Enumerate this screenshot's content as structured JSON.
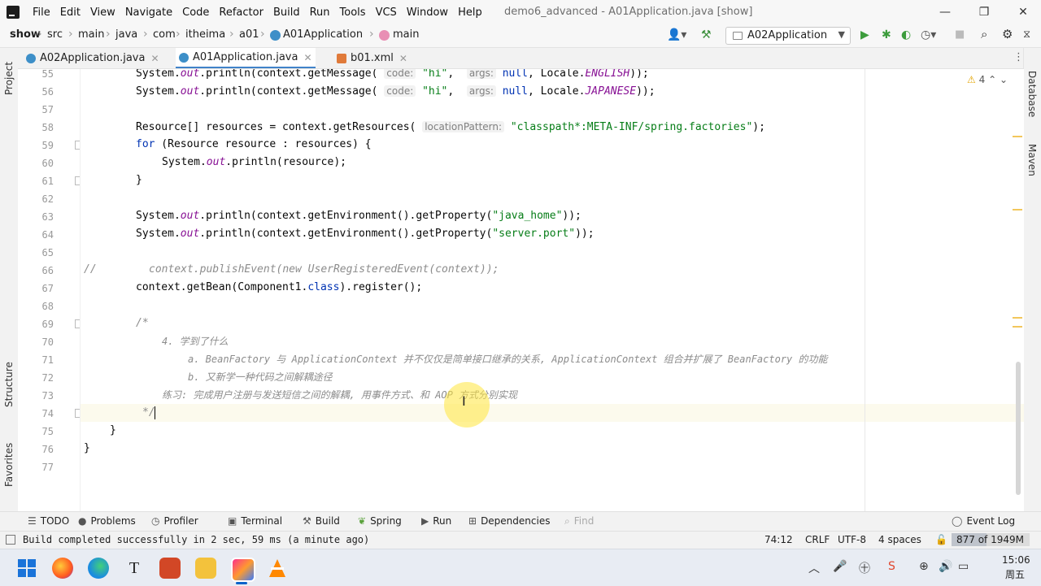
{
  "window": {
    "menu": [
      "File",
      "Edit",
      "View",
      "Navigate",
      "Code",
      "Refactor",
      "Build",
      "Run",
      "Tools",
      "VCS",
      "Window",
      "Help"
    ],
    "title": "demo6_advanced - A01Application.java [show]"
  },
  "breadcrumbs": [
    "show",
    "src",
    "main",
    "java",
    "com",
    "itheima",
    "a01",
    "A01Application",
    "main"
  ],
  "run_config": "A02Application",
  "tabs": [
    {
      "label": "A02Application.java",
      "active": false
    },
    {
      "label": "A01Application.java",
      "active": true
    },
    {
      "label": "b01.xml",
      "active": false
    }
  ],
  "left_strip": {
    "project": "Project",
    "structure": "Structure",
    "favorites": "Favorites"
  },
  "right_strip": {
    "database": "Database",
    "maven": "Maven"
  },
  "inspection": {
    "count": "4"
  },
  "line_numbers": [
    "55",
    "56",
    "57",
    "58",
    "59",
    "60",
    "61",
    "62",
    "63",
    "64",
    "65",
    "66",
    "67",
    "68",
    "69",
    "70",
    "71",
    "72",
    "73",
    "74",
    "75",
    "76",
    "77"
  ],
  "code": {
    "l55_a": "System.",
    "l55_b": "out",
    "l55_c": ".println(context.getMessage(",
    "l55_hint1": "code:",
    "l55_str": "\"hi\"",
    "l55_hint2": "args:",
    "l55_null": "null",
    "l55_d": ", Locale.",
    "l55_e": "ENGLISH",
    "l55_f": "));",
    "l56_e": "JAPANESE",
    "l58_a": "Resource[] resources = context.getResources(",
    "l58_hint": "locationPattern:",
    "l58_str": "\"classpath*:META-INF/spring.factories\"",
    "l58_b": ");",
    "l59_kw": "for",
    "l59_b": " (Resource resource : resources) {",
    "l60_a": "System.",
    "l60_b": "out",
    "l60_c": ".println(resource);",
    "l61": "}",
    "l63_c": ".println(context.getEnvironment().getProperty(",
    "l63_str": "\"java_home\"",
    "l63_d": "));",
    "l64_str": "\"server.port\"",
    "l66_a": "//",
    "l66_b": "context.publishEvent(new UserRegisteredEvent(context));",
    "l67_a": "context.getBean(Component1.",
    "l67_kw": "class",
    "l67_b": ").register();",
    "l69": "/*",
    "l70": "4. 学到了什么",
    "l71": "a. BeanFactory 与 ApplicationContext 并不仅仅是简单接口继承的关系, ApplicationContext 组合并扩展了 BeanFactory 的功能",
    "l72": "b. 又新学一种代码之间解耦途径",
    "l73": "练习: 完成用户注册与发送短信之间的解耦, 用事件方式、和 AOP 方式分别实现",
    "l74": "*/",
    "l75": "}",
    "l76": "}"
  },
  "bottom_tools": [
    "TODO",
    "Problems",
    "Profiler",
    "Terminal",
    "Build",
    "Spring",
    "Run",
    "Dependencies",
    "Find"
  ],
  "event_log": "Event Log",
  "status": {
    "message": "Build completed successfully in 2 sec, 59 ms (a minute ago)",
    "position": "74:12",
    "line_sep": "CRLF",
    "encoding": "UTF-8",
    "indent": "4 spaces",
    "memory": "877 of 1949M"
  },
  "taskbar": {
    "time": "15:06",
    "day": "周五",
    "text_app": "T"
  }
}
